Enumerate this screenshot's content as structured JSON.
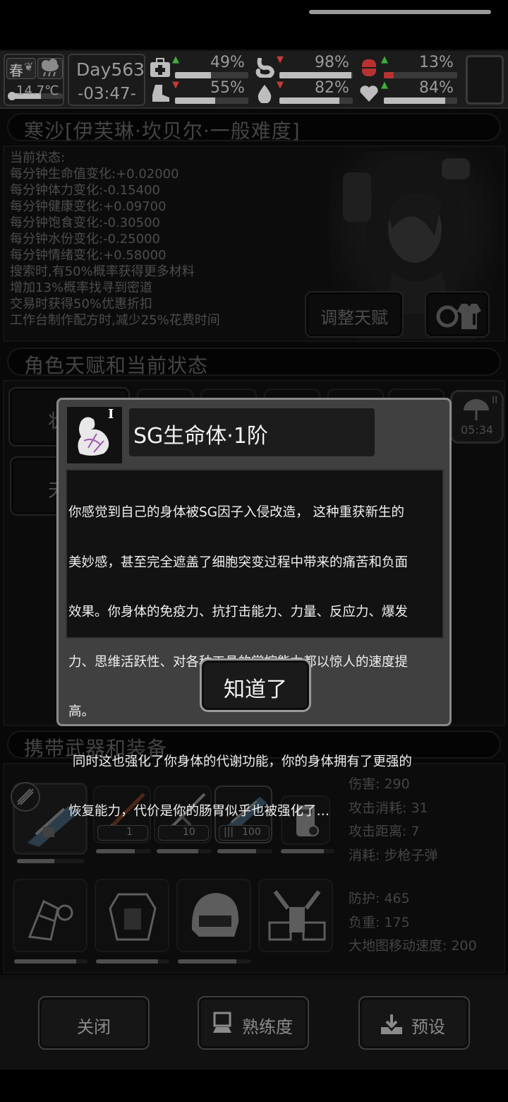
{
  "status_bar": {
    "season": "春",
    "temperature": "14.7℃",
    "day": "Day563",
    "time": "-03:47-",
    "stats": [
      {
        "icon": "medkit-icon",
        "pct": "49%",
        "level": 0.49,
        "trend": "up"
      },
      {
        "icon": "stomach-icon",
        "pct": "98%",
        "level": 0.98,
        "trend": "down"
      },
      {
        "icon": "pill-icon",
        "pct": "13%",
        "level": 0.13,
        "trend": "up"
      },
      {
        "icon": "boot-icon",
        "pct": "55%",
        "level": 0.55,
        "trend": "down"
      },
      {
        "icon": "water-drop-icon",
        "pct": "82%",
        "level": 0.82,
        "trend": "down"
      },
      {
        "icon": "heart-icon",
        "pct": "84%",
        "level": 0.84,
        "trend": "up"
      }
    ],
    "colors": {
      "up": "#3fae3f",
      "down": "#c23a3a",
      "pill": "#b83232"
    }
  },
  "character": {
    "title": "寒沙[伊芙琳·坎贝尔·一般难度]",
    "state_header": "当前状态:",
    "lines": [
      "每分钟生命值变化:+0.02000",
      "每分钟体力变化:-0.15400",
      "每分钟健康变化:+0.09700",
      "每分钟饱食变化:-0.30500",
      "每分钟水份变化:-0.25000",
      "每分钟情绪变化:+0.58000",
      "搜索时,有50%概率获得更多材料",
      "增加13%概率找寻到密道",
      "交易时获得50%优惠折扣",
      "工作台制作配方时,减少25%花费时间"
    ],
    "adjust_talent_label": "调整天赋"
  },
  "talents": {
    "title": "角色天赋和当前状态",
    "tab_left_top": "状",
    "tab_left_bottom": "天",
    "timer": "05:34",
    "timer_badge": "II"
  },
  "dialog": {
    "tier_badge": "I",
    "title": "SG生命体·1阶",
    "body_lines": [
      "你感觉到自己的身体被SG因子入侵改造， 这种重获新生的",
      "美妙感，甚至完全遮盖了细胞突变过程中带来的痛苦和负面",
      "效果。你身体的免疫力、抗打击能力、力量、反应力、爆发",
      "力、思维活跃性、对各种工具的掌控能力都以惊人的速度提",
      "高。",
      " 同时这也强化了你身体的代谢功能，你的身体拥有了更强的",
      "恢复能力，代价是你的肠胃似乎也被强化了…"
    ],
    "ok_label": "知道了"
  },
  "gear": {
    "title": "携带武器和装备",
    "weapon_counts": [
      "1",
      "10",
      "100"
    ],
    "weapon_durability": [
      0.55,
      0.7,
      0.75,
      0.7
    ],
    "weapon_stats": [
      "伤害: 290",
      "攻击消耗: 31",
      "攻击距离: 7",
      "消耗: 步枪子弹"
    ],
    "armor_durability": [
      0.85,
      0.85,
      0.8
    ],
    "armor_stats": [
      "防护: 465",
      "负重: 175",
      "大地图移动速度: 200"
    ]
  },
  "bottom": {
    "close_label": "关闭",
    "proficiency_label": "熟练度",
    "preset_label": "预设"
  }
}
